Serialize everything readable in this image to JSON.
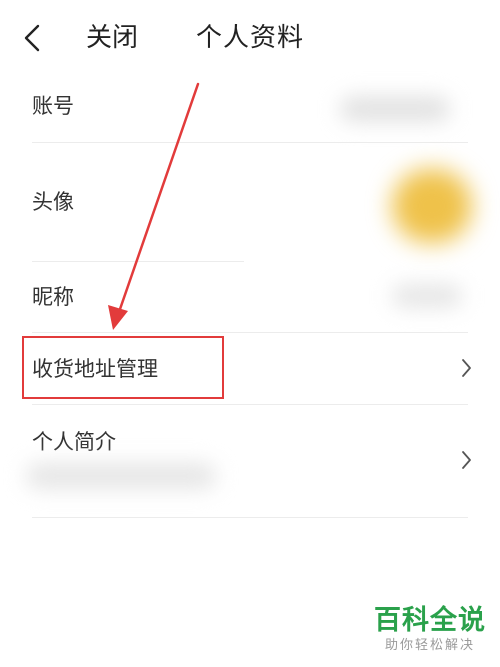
{
  "header": {
    "back_icon": "chevron-left-icon",
    "close_label": "关闭",
    "title": "个人资料"
  },
  "rows": {
    "account": {
      "label": "账号"
    },
    "avatar": {
      "label": "头像"
    },
    "nickname": {
      "label": "昵称"
    },
    "address": {
      "label": "收货地址管理",
      "chevron_icon": "chevron-right-icon"
    },
    "bio": {
      "label": "个人简介",
      "chevron_icon": "chevron-right-icon"
    }
  },
  "annotation": {
    "color": "#e23b3b",
    "arrow_icon": "red-arrow-icon"
  },
  "watermark": {
    "main": "百科全说",
    "sub": "助你轻松解决",
    "color": "#2aa14b"
  }
}
